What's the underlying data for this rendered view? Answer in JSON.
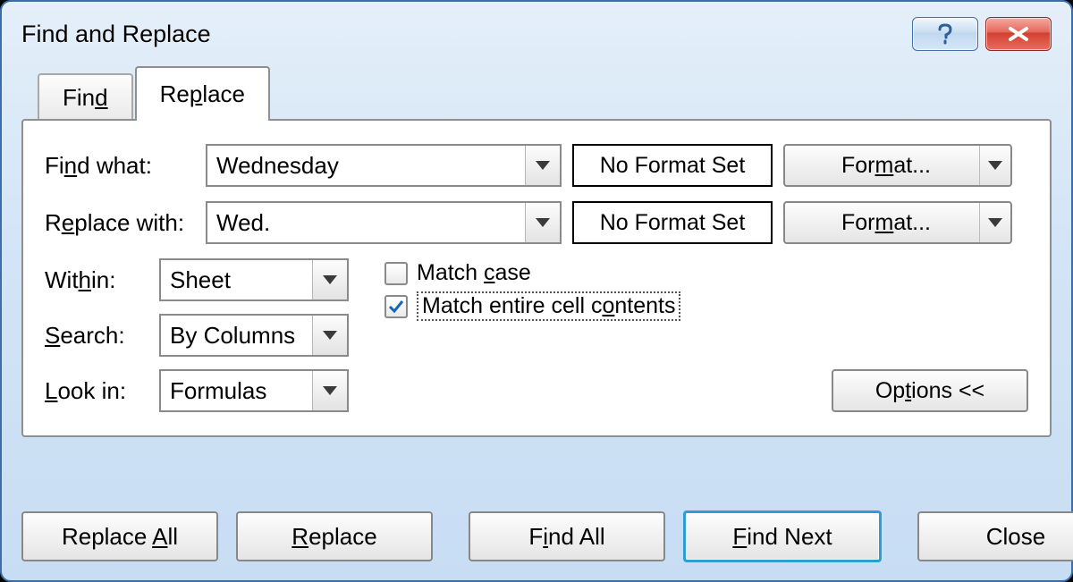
{
  "window": {
    "title": "Find and Replace"
  },
  "tabs": {
    "find": "Find",
    "replace": "Replace"
  },
  "fields": {
    "find_what_label": "Find what:",
    "find_what_value": "Wednesday",
    "replace_with_label": "Replace with:",
    "replace_with_value": "Wed.",
    "format_status": "No Format Set",
    "format_button": "Format...",
    "within_label": "Within:",
    "within_value": "Sheet",
    "search_label": "Search:",
    "search_value": "By Columns",
    "lookin_label": "Look in:",
    "lookin_value": "Formulas"
  },
  "checks": {
    "match_case_label": "Match case",
    "match_case_checked": false,
    "match_entire_label": "Match entire cell contents",
    "match_entire_checked": true
  },
  "options_button": "Options <<",
  "buttons": {
    "replace_all": "Replace All",
    "replace": "Replace",
    "find_all": "Find All",
    "find_next": "Find Next",
    "close": "Close"
  }
}
